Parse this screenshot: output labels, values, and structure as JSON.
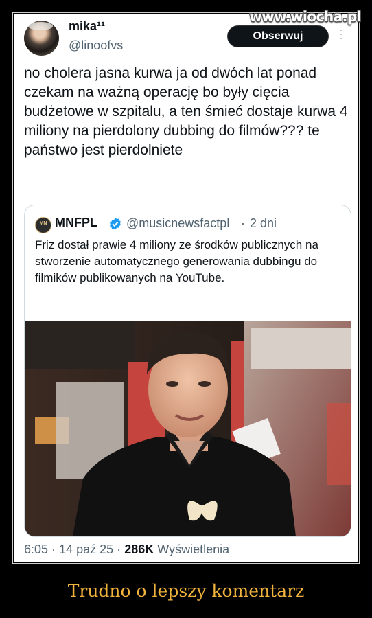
{
  "watermark": "www.wiocha.pl",
  "tweet": {
    "author_name": "mika¹¹",
    "author_handle": "@linoofvs",
    "follow_label": "Obserwuj",
    "more_icon": "more-vertical-icon",
    "text": "no cholera jasna kurwa ja od dwóch lat ponad czekam na ważną operację bo były cięcia budżetowe w szpitalu, a ten śmieć dostaje kurwa 4 miliony na pierdolony dubbing do filmów??? te państwo jest pierdolniete"
  },
  "quote": {
    "author_name": "MNFPL",
    "verified_icon": "verified-badge-icon",
    "author_handle": "@musicnewsfactpl",
    "separator": "·",
    "time": "2 dni",
    "text": "Friz dostał prawie 4 miliony ze środków publicznych na stworzenie automatycznego generowania dubbingu do filmików publikowanych na YouTube."
  },
  "meta": {
    "time": "6:05",
    "sep1": "·",
    "date": "14 paź 25",
    "sep2": "·",
    "views_count": "286K",
    "views_label": "Wyświetlenia"
  },
  "caption": "Trudno o lepszy komentarz",
  "colors": {
    "caption": "#f2b33d",
    "verified": "#1d9bf0",
    "text_secondary": "#536471"
  }
}
